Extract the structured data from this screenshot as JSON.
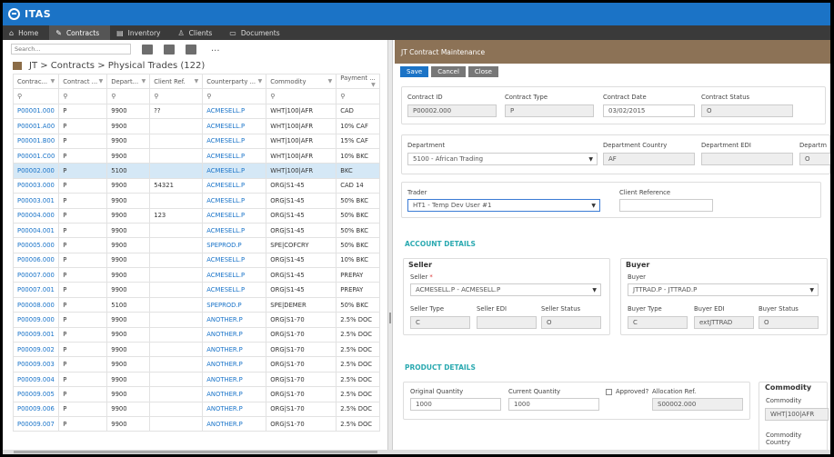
{
  "app": {
    "title": "ITAS"
  },
  "nav": [
    {
      "label": "Home",
      "icon": "home-icon",
      "glyph": "⌂"
    },
    {
      "label": "Contracts",
      "icon": "pen-icon",
      "glyph": "✎"
    },
    {
      "label": "Inventory",
      "icon": "inventory-icon",
      "glyph": "▤"
    },
    {
      "label": "Clients",
      "icon": "person-icon",
      "glyph": "♙"
    },
    {
      "label": "Documents",
      "icon": "document-icon",
      "glyph": "▭"
    }
  ],
  "left": {
    "search_placeholder": "Search...",
    "more": "...",
    "breadcrumb": "JT > Contracts > Physical Trades (122)",
    "columns": [
      "Contrac...",
      "Contract ...",
      "Depart...",
      "Client Ref.",
      "Counterparty ...",
      "Commodity",
      "Payment ..."
    ],
    "filter_glyph": "⚲",
    "rows": [
      [
        "P00001.000",
        "P",
        "9900",
        "??",
        "ACMESELL.P",
        "WHT|100|AFR",
        "CAD"
      ],
      [
        "P00001.A00",
        "P",
        "9900",
        "",
        "ACMESELL.P",
        "WHT|100|AFR",
        "10% CAF"
      ],
      [
        "P00001.B00",
        "P",
        "9900",
        "",
        "ACMESELL.P",
        "WHT|100|AFR",
        "15% CAF"
      ],
      [
        "P00001.C00",
        "P",
        "9900",
        "",
        "ACMESELL.P",
        "WHT|100|AFR",
        "10% BKC"
      ],
      [
        "P00002.000",
        "P",
        "5100",
        "",
        "ACMESELL.P",
        "WHT|100|AFR",
        "BKC"
      ],
      [
        "P00003.000",
        "P",
        "9900",
        "54321",
        "ACMESELL.P",
        "ORG|S1-45",
        "CAD 14"
      ],
      [
        "P00003.001",
        "P",
        "9900",
        "",
        "ACMESELL.P",
        "ORG|S1-45",
        "50% BKC"
      ],
      [
        "P00004.000",
        "P",
        "9900",
        "123",
        "ACMESELL.P",
        "ORG|S1-45",
        "50% BKC"
      ],
      [
        "P00004.001",
        "P",
        "9900",
        "",
        "ACMESELL.P",
        "ORG|S1-45",
        "50% BKC"
      ],
      [
        "P00005.000",
        "P",
        "9900",
        "",
        "SPEPROD.P",
        "SPE|COFCRY",
        "50% BKC"
      ],
      [
        "P00006.000",
        "P",
        "9900",
        "",
        "ACMESELL.P",
        "ORG|S1-45",
        "10% BKC"
      ],
      [
        "P00007.000",
        "P",
        "9900",
        "",
        "ACMESELL.P",
        "ORG|S1-45",
        "PREPAY"
      ],
      [
        "P00007.001",
        "P",
        "9900",
        "",
        "ACMESELL.P",
        "ORG|S1-45",
        "PREPAY"
      ],
      [
        "P00008.000",
        "P",
        "5100",
        "",
        "SPEPROD.P",
        "SPE|DEMER",
        "50% BKC"
      ],
      [
        "P00009.000",
        "P",
        "9900",
        "",
        "ANOTHER.P",
        "ORG|S1-70",
        "2.5% DOC"
      ],
      [
        "P00009.001",
        "P",
        "9900",
        "",
        "ANOTHER.P",
        "ORG|S1-70",
        "2.5% DOC"
      ],
      [
        "P00009.002",
        "P",
        "9900",
        "",
        "ANOTHER.P",
        "ORG|S1-70",
        "2.5% DOC"
      ],
      [
        "P00009.003",
        "P",
        "9900",
        "",
        "ANOTHER.P",
        "ORG|S1-70",
        "2.5% DOC"
      ],
      [
        "P00009.004",
        "P",
        "9900",
        "",
        "ANOTHER.P",
        "ORG|S1-70",
        "2.5% DOC"
      ],
      [
        "P00009.005",
        "P",
        "9900",
        "",
        "ANOTHER.P",
        "ORG|S1-70",
        "2.5% DOC"
      ],
      [
        "P00009.006",
        "P",
        "9900",
        "",
        "ANOTHER.P",
        "ORG|S1-70",
        "2.5% DOC"
      ],
      [
        "P00009.007",
        "P",
        "9900",
        "",
        "ANOTHER.P",
        "ORG|S1-70",
        "2.5% DOC"
      ]
    ],
    "selected_row": 4
  },
  "right": {
    "title": "JT Contract Maintenance",
    "buttons": {
      "save": "Save",
      "cancel": "Cancel",
      "close": "Close"
    },
    "contract": {
      "id_label": "Contract ID",
      "id_value": "P00002.000",
      "type_label": "Contract Type",
      "type_value": "P",
      "date_label": "Contract Date",
      "date_value": "03/02/2015",
      "status_label": "Contract Status",
      "status_value": "O"
    },
    "department": {
      "label": "Department",
      "value": "5100 - African Trading",
      "country_label": "Department Country",
      "country_value": "AF",
      "edi_label": "Department EDI",
      "edi_value": "",
      "extra_label": "Departm",
      "extra_value": "O"
    },
    "trader": {
      "label": "Trader",
      "value": "HT1 - Temp Dev User #1",
      "client_ref_label": "Client Reference",
      "client_ref_value": ""
    },
    "account_section": "ACCOUNT DETAILS",
    "seller": {
      "heading": "Seller",
      "label": "Seller",
      "required": "*",
      "value": "ACMESELL.P - ACMESELL.P",
      "type_label": "Seller Type",
      "type_value": "C",
      "edi_label": "Seller EDI",
      "edi_value": "",
      "status_label": "Seller Status",
      "status_value": "O"
    },
    "buyer": {
      "heading": "Buyer",
      "label": "Buyer",
      "value": "JTTRAD.P - JTTRAD.P",
      "type_label": "Buyer Type",
      "type_value": "C",
      "edi_label": "Buyer EDI",
      "edi_value": "extJTTRAD",
      "status_label": "Buyer Status",
      "status_value": "O"
    },
    "product_section": "PRODUCT DETAILS",
    "product": {
      "orig_qty_label": "Original Quantity",
      "orig_qty_value": "1000",
      "cur_qty_label": "Current Quantity",
      "cur_qty_value": "1000",
      "approved_label": "Approved?",
      "alloc_label": "Allocation Ref.",
      "alloc_value": "S00002.000"
    },
    "commodity": {
      "heading": "Commodity",
      "label": "Commodity",
      "value": "WHT|100|AFR",
      "country_label": "Commodity Country"
    }
  }
}
